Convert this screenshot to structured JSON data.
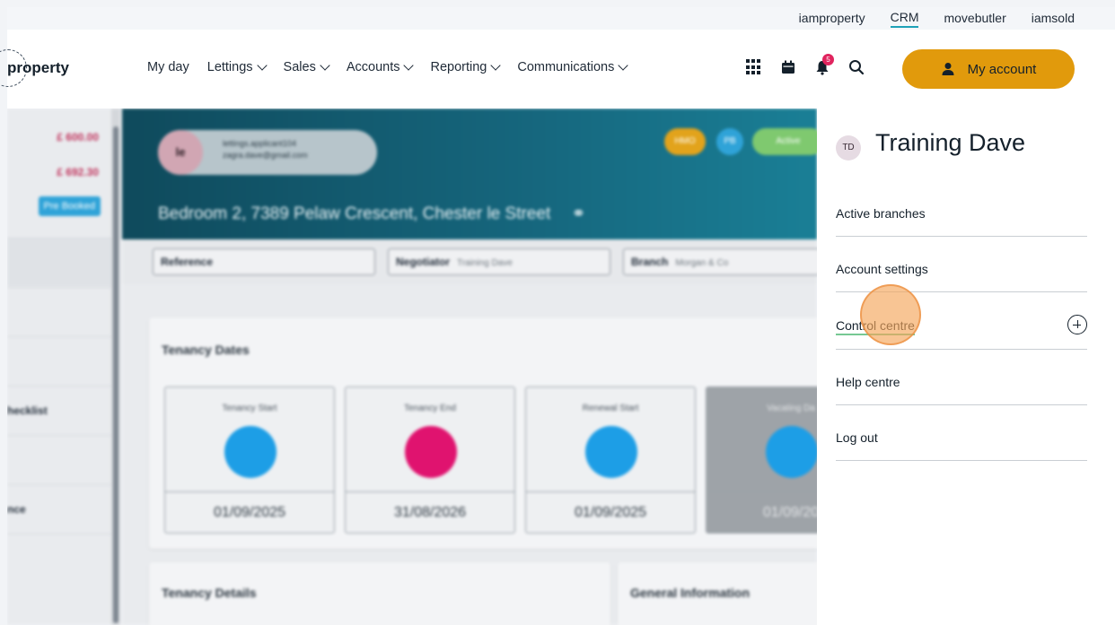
{
  "top_links": [
    "iamproperty",
    "CRM",
    "movebutler",
    "iamsold"
  ],
  "top_links_active": "CRM",
  "logo_text": "property",
  "nav": [
    "My day",
    "Lettings",
    "Sales",
    "Accounts",
    "Reporting",
    "Communications"
  ],
  "notification_count": "5",
  "account_button": "My account",
  "left_column": {
    "amounts": [
      "£ 600.00",
      "£ 692.30"
    ],
    "pre_booked": "Pre Booked",
    "rows": [
      "",
      "",
      "",
      "hecklist",
      "",
      "nce",
      ""
    ]
  },
  "banner": {
    "avatar_initials": "le",
    "email_lines": [
      "lettings.applicant104",
      "zagra.dave@gmail.com"
    ],
    "tags": [
      "HMO",
      "PB",
      "Active"
    ],
    "address": "Bedroom 2, 7389 Pelaw Crescent, Chester le Street"
  },
  "filters": {
    "reference_label": "Reference",
    "negotiator_label": "Negotiator",
    "negotiator_value": "Training Dave",
    "branch_label": "Branch",
    "branch_value": "Morgan & Co"
  },
  "tenancy_dates": {
    "title": "Tenancy Dates",
    "tiles": [
      {
        "label": "Tenancy Start",
        "date": "01/09/2025",
        "color": "#1d9ee6"
      },
      {
        "label": "Tenancy End",
        "date": "31/08/2026",
        "color": "#e0136f"
      },
      {
        "label": "Renewal Start",
        "date": "01/09/2025",
        "color": "#1d9ee6"
      },
      {
        "label": "Vacating Da",
        "date": "01/09/20",
        "color": "#1d9ee6"
      }
    ]
  },
  "sections": [
    "Tenancy Details",
    "General Information"
  ],
  "account_panel": {
    "initials": "TD",
    "name": "Training Dave",
    "items": [
      "Active branches",
      "Account settings",
      "Control centre",
      "Help centre",
      "Log out"
    ]
  },
  "colors": {
    "accent_orange": "#e19a0c",
    "banner_teal": "#0f4a5c",
    "pink": "#e0136f",
    "blue": "#1d9ee6"
  }
}
